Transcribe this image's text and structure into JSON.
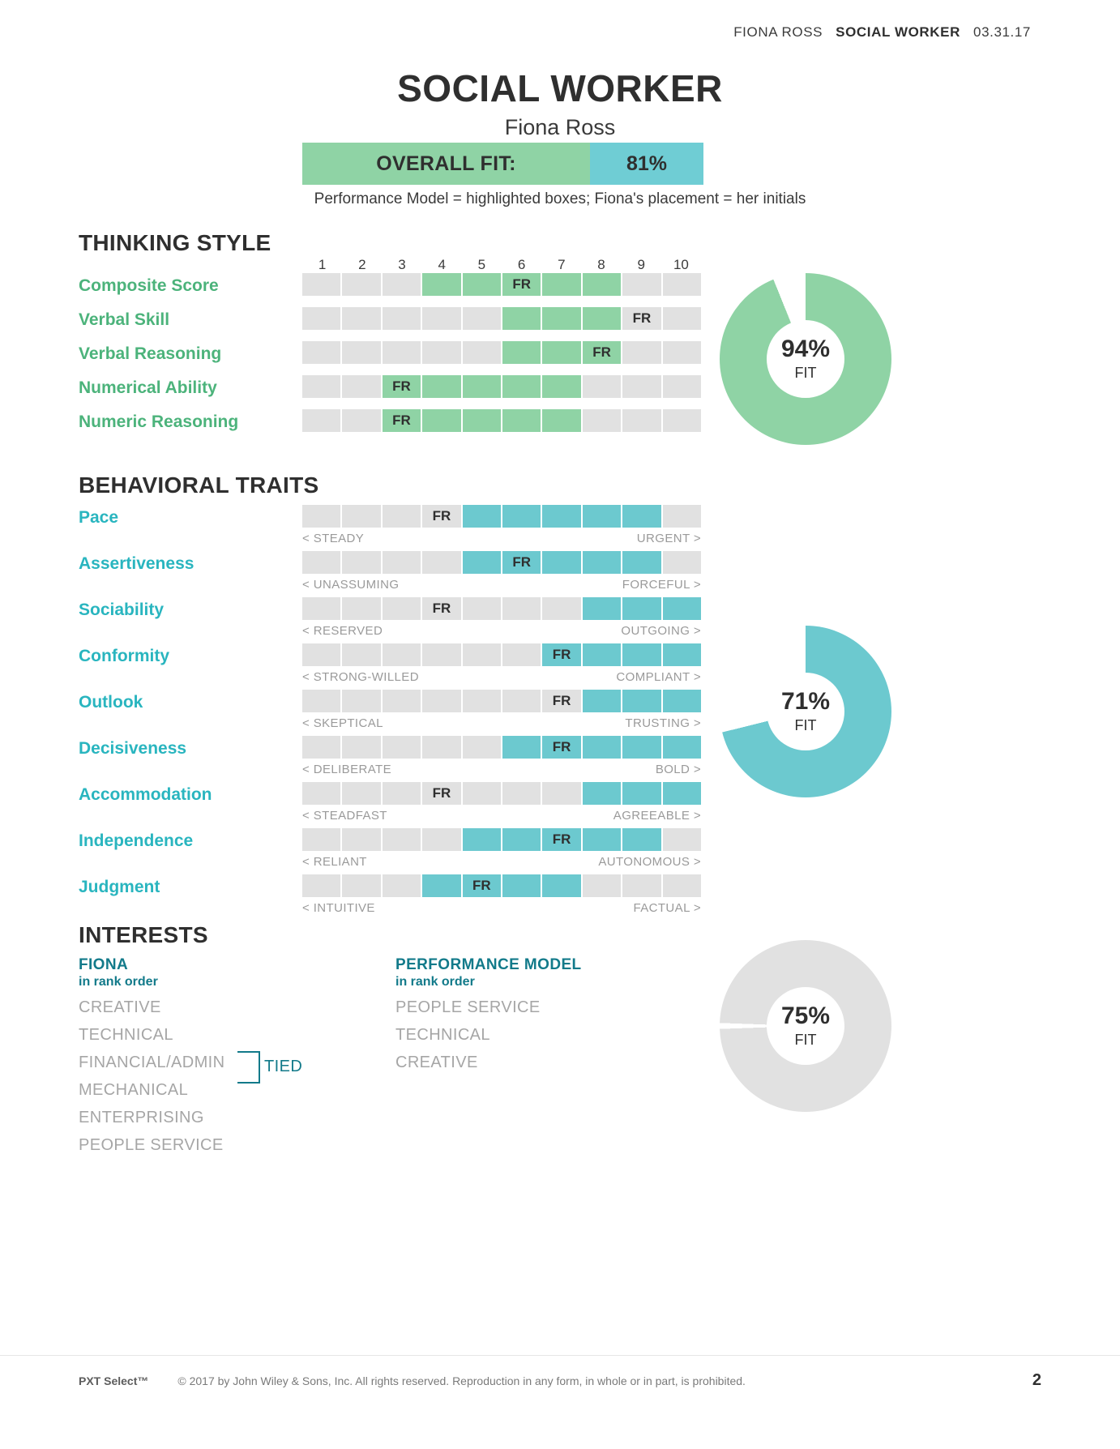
{
  "topbar": {
    "name": "FIONA ROSS",
    "role": "SOCIAL WORKER",
    "date": "03.31.17"
  },
  "title": {
    "main": "SOCIAL WORKER",
    "sub": "Fiona Ross"
  },
  "overall_fit": {
    "label": "OVERALL FIT:",
    "value": "81%"
  },
  "legend_note": "Performance Model = highlighted boxes; Fiona's placement = her initials",
  "marker": "FR",
  "sections": {
    "thinking": {
      "heading": "THINKING STYLE"
    },
    "behavior": {
      "heading": "BEHAVIORAL TRAITS"
    },
    "interests": {
      "heading": "INTERESTS"
    }
  },
  "scale_numbers": [
    "1",
    "2",
    "3",
    "4",
    "5",
    "6",
    "7",
    "8",
    "9",
    "10"
  ],
  "colors": {
    "green": "#8fd3a5",
    "green_text": "#4cb37b",
    "teal": "#6cc9cf",
    "teal_text": "#29b5bf",
    "track": "#e1e1e1",
    "interest_head": "#127a8a",
    "interest_item": "#a6a6a6"
  },
  "chart_data": [
    {
      "type": "bar",
      "title": "THINKING STYLE",
      "scale": [
        1,
        10
      ],
      "categories": [
        "Composite Score",
        "Verbal Skill",
        "Verbal Reasoning",
        "Numerical Ability",
        "Numeric Reasoning"
      ],
      "series": [
        {
          "name": "Performance Model range (highlighted boxes)",
          "ranges": [
            [
              4,
              8
            ],
            [
              6,
              8
            ],
            [
              6,
              8
            ],
            [
              3,
              7
            ],
            [
              3,
              7
            ]
          ]
        },
        {
          "name": "Fiona placement (FR)",
          "values": [
            6,
            9,
            8,
            3,
            3
          ]
        }
      ],
      "fit": {
        "value": 94,
        "label": "94%",
        "sublabel": "FIT",
        "color": "#8fd3a5"
      }
    },
    {
      "type": "bar",
      "title": "BEHAVIORAL TRAITS",
      "scale": [
        1,
        10
      ],
      "categories": [
        "Pace",
        "Assertiveness",
        "Sociability",
        "Conformity",
        "Outlook",
        "Decisiveness",
        "Accommodation",
        "Independence",
        "Judgment"
      ],
      "series": [
        {
          "name": "Performance Model range (highlighted boxes)",
          "ranges": [
            [
              5,
              9
            ],
            [
              5,
              9
            ],
            [
              8,
              10
            ],
            [
              7,
              10
            ],
            [
              8,
              10
            ],
            [
              6,
              10
            ],
            [
              8,
              10
            ],
            [
              5,
              9
            ],
            [
              4,
              7
            ]
          ]
        },
        {
          "name": "Fiona placement (FR)",
          "values": [
            4,
            6,
            4,
            7,
            7,
            7,
            4,
            7,
            5
          ]
        }
      ],
      "fit": {
        "value": 71,
        "label": "71%",
        "sublabel": "FIT",
        "color": "#6cc9cf"
      }
    },
    {
      "type": "table",
      "title": "INTERESTS",
      "columns": [
        "FIONA",
        "PERFORMANCE MODEL"
      ],
      "fiona_rank_order": [
        "CREATIVE",
        "TECHNICAL",
        "FINANCIAL/ADMIN",
        "MECHANICAL",
        "ENTERPRISING",
        "PEOPLE SERVICE"
      ],
      "model_rank_order": [
        "PEOPLE SERVICE",
        "TECHNICAL",
        "CREATIVE"
      ],
      "tied_label": "TIED",
      "tied_items": [
        "FINANCIAL/ADMIN",
        "MECHANICAL"
      ],
      "fit": {
        "value": 75,
        "label": "75%",
        "sublabel": "FIT",
        "color": "#e1e1e1"
      }
    }
  ],
  "thinking_rows": [
    {
      "label": "Composite Score",
      "from": 4,
      "to": 8,
      "fr": 6
    },
    {
      "label": "Verbal Skill",
      "from": 6,
      "to": 8,
      "fr": 9
    },
    {
      "label": "Verbal Reasoning",
      "from": 6,
      "to": 8,
      "fr": 8
    },
    {
      "label": "Numerical Ability",
      "from": 3,
      "to": 7,
      "fr": 3
    },
    {
      "label": "Numeric Reasoning",
      "from": 3,
      "to": 7,
      "fr": 3
    }
  ],
  "behavior_rows": [
    {
      "label": "Pace",
      "from": 5,
      "to": 9,
      "fr": 4,
      "left": "< STEADY",
      "right": "URGENT >"
    },
    {
      "label": "Assertiveness",
      "from": 5,
      "to": 9,
      "fr": 6,
      "left": "< UNASSUMING",
      "right": "FORCEFUL >"
    },
    {
      "label": "Sociability",
      "from": 8,
      "to": 10,
      "fr": 4,
      "left": "< RESERVED",
      "right": "OUTGOING >"
    },
    {
      "label": "Conformity",
      "from": 7,
      "to": 10,
      "fr": 7,
      "left": "< STRONG-WILLED",
      "right": "COMPLIANT >"
    },
    {
      "label": "Outlook",
      "from": 8,
      "to": 10,
      "fr": 7,
      "left": "< SKEPTICAL",
      "right": "TRUSTING >"
    },
    {
      "label": "Decisiveness",
      "from": 6,
      "to": 10,
      "fr": 7,
      "left": "< DELIBERATE",
      "right": "BOLD >"
    },
    {
      "label": "Accommodation",
      "from": 8,
      "to": 10,
      "fr": 4,
      "left": "< STEADFAST",
      "right": "AGREEABLE >"
    },
    {
      "label": "Independence",
      "from": 5,
      "to": 9,
      "fr": 7,
      "left": "< RELIANT",
      "right": "AUTONOMOUS >"
    },
    {
      "label": "Judgment",
      "from": 4,
      "to": 7,
      "fr": 5,
      "left": "< INTUITIVE",
      "right": "FACTUAL >"
    }
  ],
  "donuts": {
    "thinking": {
      "pct": "94%",
      "fit": "FIT"
    },
    "behavior": {
      "pct": "71%",
      "fit": "FIT"
    },
    "interests": {
      "pct": "75%",
      "fit": "FIT"
    }
  },
  "interests": {
    "fiona": {
      "head": "FIONA",
      "sub": "in rank order",
      "items": [
        "CREATIVE",
        "TECHNICAL",
        "FINANCIAL/ADMIN",
        "MECHANICAL",
        "ENTERPRISING",
        "PEOPLE SERVICE"
      ]
    },
    "model": {
      "head": "PERFORMANCE MODEL",
      "sub": "in rank order",
      "items": [
        "PEOPLE SERVICE",
        "TECHNICAL",
        "CREATIVE"
      ]
    },
    "tied": "TIED"
  },
  "footer": {
    "brand": "PXT Select™",
    "copy": "© 2017 by John Wiley & Sons, Inc. All rights reserved. Reproduction in any form, in whole or in part, is prohibited.",
    "page": "2"
  }
}
